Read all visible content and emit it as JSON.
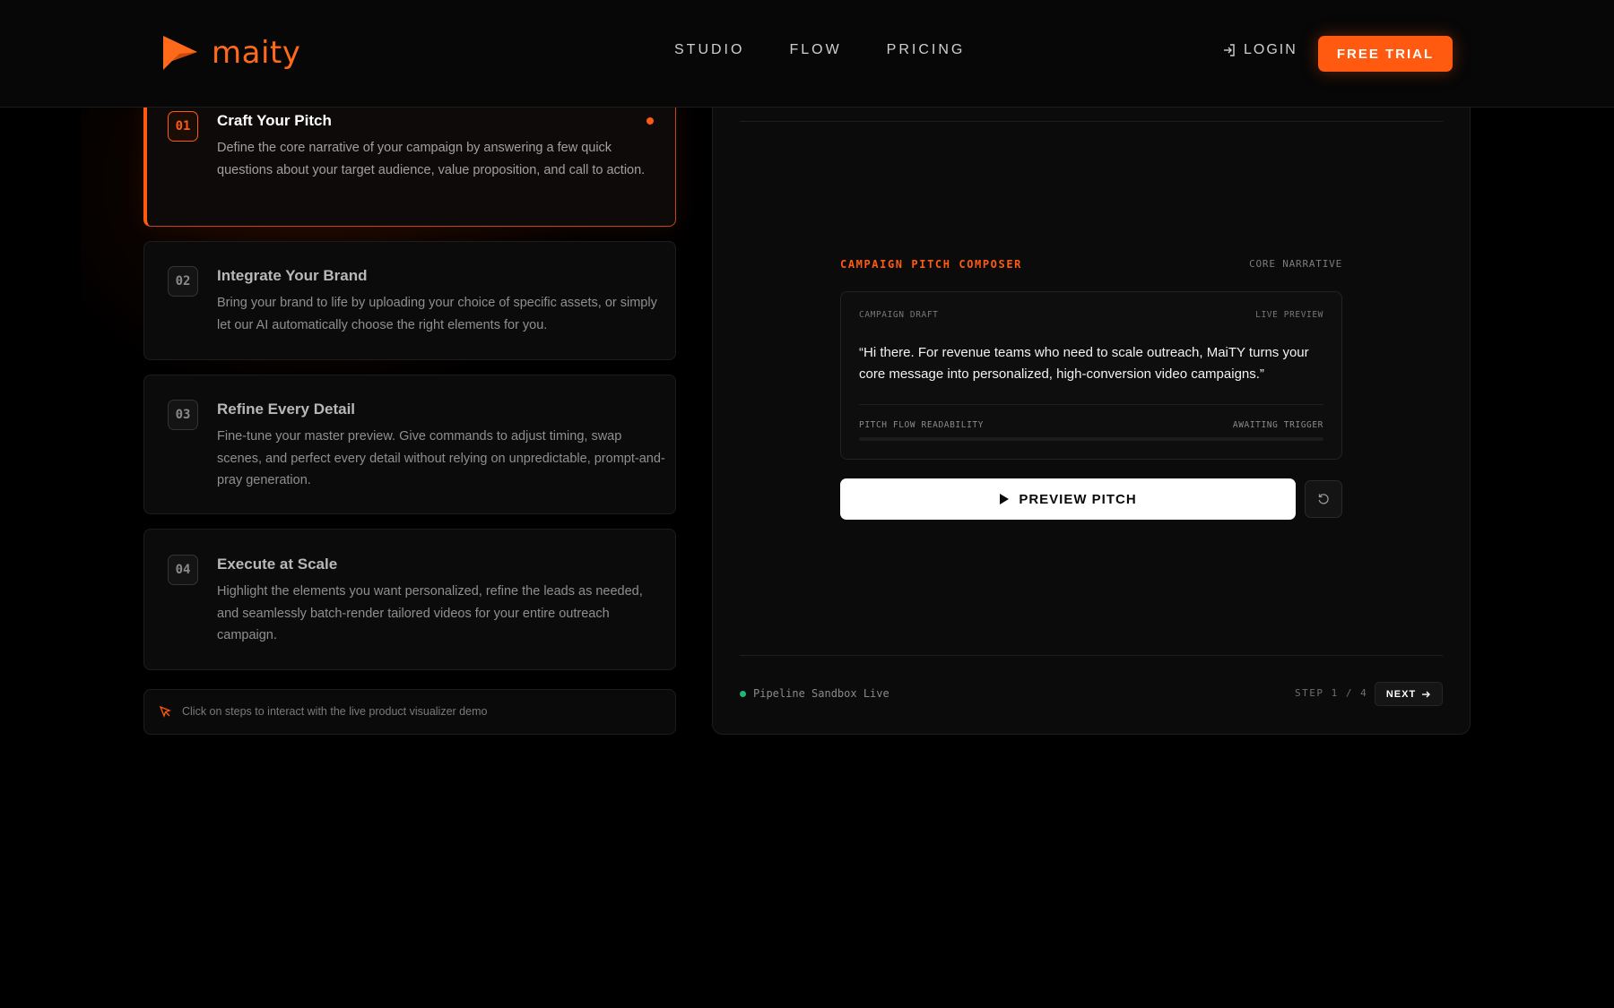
{
  "brand": {
    "name": "maity",
    "accent": "#ff5a10"
  },
  "nav": {
    "links": [
      "STUDIO",
      "FLOW",
      "PRICING"
    ],
    "login": "LOGIN",
    "cta": "FREE TRIAL"
  },
  "steps": [
    {
      "num": "01",
      "title": "Craft Your Pitch",
      "desc": "Define the core narrative of your campaign by answering a few quick questions about your target audience, value proposition, and call to action.",
      "active": true
    },
    {
      "num": "02",
      "title": "Integrate Your Brand",
      "desc": "Bring your brand to life by uploading your choice of specific assets, or simply let our AI automatically choose the right elements for you.",
      "active": false
    },
    {
      "num": "03",
      "title": "Refine Every Detail",
      "desc": "Fine-tune your master preview. Give commands to adjust timing, swap scenes, and perfect every detail without relying on unpredictable, prompt-and-pray generation.",
      "active": false
    },
    {
      "num": "04",
      "title": "Execute at Scale",
      "desc": "Highlight the elements you want personalized, refine the leads as needed, and seamlessly batch-render tailored videos for your entire outreach campaign.",
      "active": false
    }
  ],
  "hint": "Click on steps to interact with the live product visualizer demo",
  "panel": {
    "composer_title": "CAMPAIGN PITCH COMPOSER",
    "composer_meta": "CORE NARRATIVE",
    "draft_label": "CAMPAIGN DRAFT",
    "draft_live": "LIVE PREVIEW",
    "draft_text": "“Hi there. For revenue teams who need to scale outreach, MaiTY turns your core message into personalized, high-conversion video campaigns.”",
    "flow_label": "PITCH FLOW READABILITY",
    "flow_status": "AWAITING TRIGGER",
    "flow_progress": 0,
    "preview_button": "PREVIEW PITCH",
    "status_text": "Pipeline Sandbox Live",
    "step_indicator": "STEP 1 / 4",
    "next_button": "NEXT"
  }
}
